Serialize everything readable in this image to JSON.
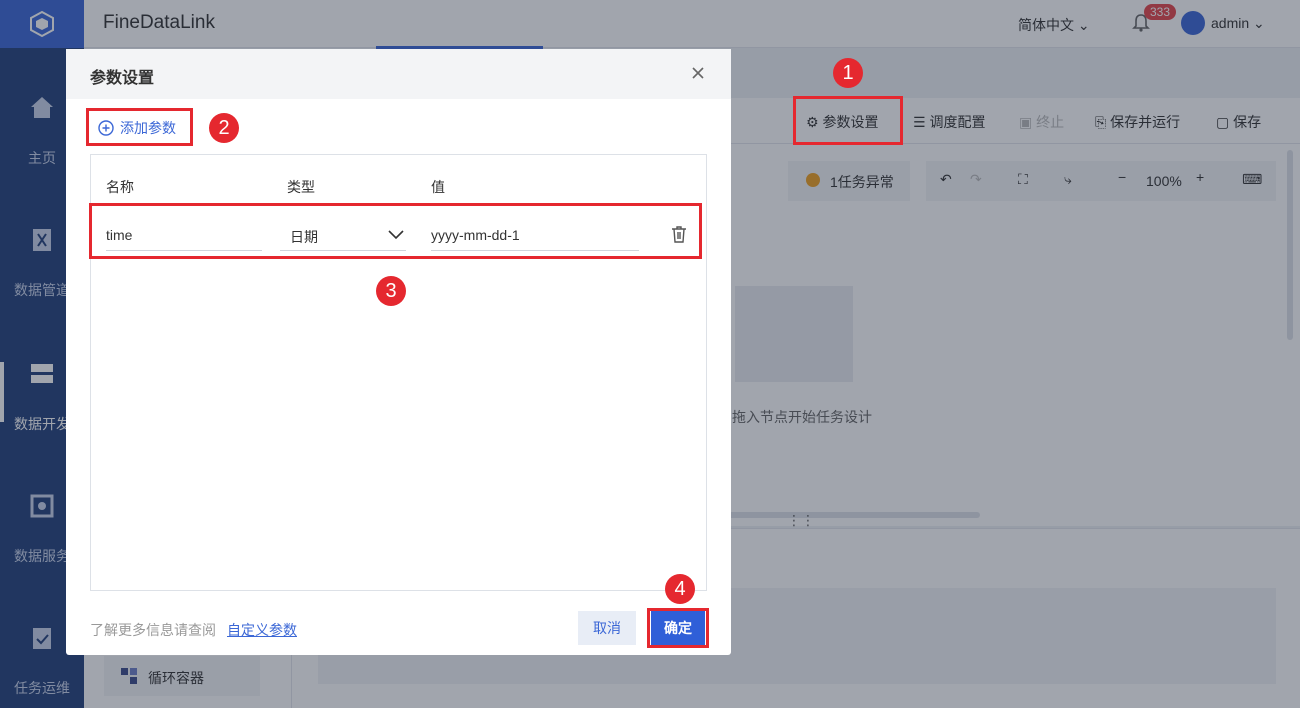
{
  "app": {
    "title": "FineDataLink",
    "language": "简体中文",
    "notification_count": "333",
    "user": "admin"
  },
  "sidebar": {
    "items": [
      {
        "label": "主页",
        "icon": "home-icon"
      },
      {
        "label": "数据管道",
        "icon": "pipeline-icon"
      },
      {
        "label": "数据开发",
        "icon": "dev-icon"
      },
      {
        "label": "数据服务",
        "icon": "service-icon"
      },
      {
        "label": "任务运维",
        "icon": "ops-icon"
      }
    ]
  },
  "toolbar": {
    "param_settings": "参数设置",
    "schedule_config": "调度配置",
    "stop": "终止",
    "save_and_run": "保存并运行",
    "save": "保存"
  },
  "canvas": {
    "task_error": "1任务异常",
    "zoom": "100%",
    "hint": "拖入节点开始任务设计"
  },
  "left_panel": {
    "loop_container": "循环容器"
  },
  "dialog": {
    "title": "参数设置",
    "add_param": "添加参数",
    "columns": {
      "name": "名称",
      "type": "类型",
      "value": "值"
    },
    "row": {
      "name": "time",
      "type": "日期",
      "value": "yyyy-mm-dd-1"
    },
    "footer_text": "了解更多信息请查阅",
    "footer_link": "自定义参数",
    "cancel": "取消",
    "ok": "确定"
  },
  "annotations": [
    "1",
    "2",
    "3",
    "4"
  ],
  "colors": {
    "accent": "#3b67d6",
    "highlight": "#e5282f",
    "sidebar": "#23407b"
  }
}
